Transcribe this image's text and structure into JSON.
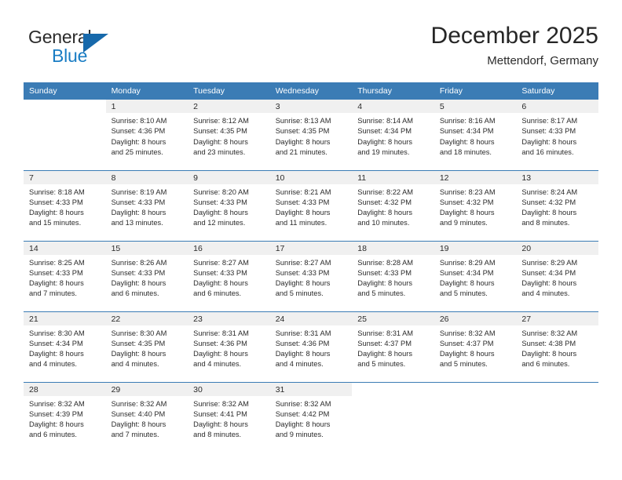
{
  "logo": {
    "word1": "General",
    "word2": "Blue",
    "triangle_color": "#1769ab",
    "blue_text_color": "#1a7dc4"
  },
  "header": {
    "title": "December 2025",
    "subtitle": "Mettendorf, Germany"
  },
  "theme": {
    "header_blue": "#3b7cb5",
    "daynum_band": "#f0f0f0",
    "text": "#2b2b2b"
  },
  "weekdays": [
    "Sunday",
    "Monday",
    "Tuesday",
    "Wednesday",
    "Thursday",
    "Friday",
    "Saturday"
  ],
  "weeks": [
    [
      {
        "day": "",
        "sunrise": "",
        "sunset": "",
        "daylight1": "",
        "daylight2": ""
      },
      {
        "day": "1",
        "sunrise": "Sunrise: 8:10 AM",
        "sunset": "Sunset: 4:36 PM",
        "daylight1": "Daylight: 8 hours",
        "daylight2": "and 25 minutes."
      },
      {
        "day": "2",
        "sunrise": "Sunrise: 8:12 AM",
        "sunset": "Sunset: 4:35 PM",
        "daylight1": "Daylight: 8 hours",
        "daylight2": "and 23 minutes."
      },
      {
        "day": "3",
        "sunrise": "Sunrise: 8:13 AM",
        "sunset": "Sunset: 4:35 PM",
        "daylight1": "Daylight: 8 hours",
        "daylight2": "and 21 minutes."
      },
      {
        "day": "4",
        "sunrise": "Sunrise: 8:14 AM",
        "sunset": "Sunset: 4:34 PM",
        "daylight1": "Daylight: 8 hours",
        "daylight2": "and 19 minutes."
      },
      {
        "day": "5",
        "sunrise": "Sunrise: 8:16 AM",
        "sunset": "Sunset: 4:34 PM",
        "daylight1": "Daylight: 8 hours",
        "daylight2": "and 18 minutes."
      },
      {
        "day": "6",
        "sunrise": "Sunrise: 8:17 AM",
        "sunset": "Sunset: 4:33 PM",
        "daylight1": "Daylight: 8 hours",
        "daylight2": "and 16 minutes."
      }
    ],
    [
      {
        "day": "7",
        "sunrise": "Sunrise: 8:18 AM",
        "sunset": "Sunset: 4:33 PM",
        "daylight1": "Daylight: 8 hours",
        "daylight2": "and 15 minutes."
      },
      {
        "day": "8",
        "sunrise": "Sunrise: 8:19 AM",
        "sunset": "Sunset: 4:33 PM",
        "daylight1": "Daylight: 8 hours",
        "daylight2": "and 13 minutes."
      },
      {
        "day": "9",
        "sunrise": "Sunrise: 8:20 AM",
        "sunset": "Sunset: 4:33 PM",
        "daylight1": "Daylight: 8 hours",
        "daylight2": "and 12 minutes."
      },
      {
        "day": "10",
        "sunrise": "Sunrise: 8:21 AM",
        "sunset": "Sunset: 4:33 PM",
        "daylight1": "Daylight: 8 hours",
        "daylight2": "and 11 minutes."
      },
      {
        "day": "11",
        "sunrise": "Sunrise: 8:22 AM",
        "sunset": "Sunset: 4:32 PM",
        "daylight1": "Daylight: 8 hours",
        "daylight2": "and 10 minutes."
      },
      {
        "day": "12",
        "sunrise": "Sunrise: 8:23 AM",
        "sunset": "Sunset: 4:32 PM",
        "daylight1": "Daylight: 8 hours",
        "daylight2": "and 9 minutes."
      },
      {
        "day": "13",
        "sunrise": "Sunrise: 8:24 AM",
        "sunset": "Sunset: 4:32 PM",
        "daylight1": "Daylight: 8 hours",
        "daylight2": "and 8 minutes."
      }
    ],
    [
      {
        "day": "14",
        "sunrise": "Sunrise: 8:25 AM",
        "sunset": "Sunset: 4:33 PM",
        "daylight1": "Daylight: 8 hours",
        "daylight2": "and 7 minutes."
      },
      {
        "day": "15",
        "sunrise": "Sunrise: 8:26 AM",
        "sunset": "Sunset: 4:33 PM",
        "daylight1": "Daylight: 8 hours",
        "daylight2": "and 6 minutes."
      },
      {
        "day": "16",
        "sunrise": "Sunrise: 8:27 AM",
        "sunset": "Sunset: 4:33 PM",
        "daylight1": "Daylight: 8 hours",
        "daylight2": "and 6 minutes."
      },
      {
        "day": "17",
        "sunrise": "Sunrise: 8:27 AM",
        "sunset": "Sunset: 4:33 PM",
        "daylight1": "Daylight: 8 hours",
        "daylight2": "and 5 minutes."
      },
      {
        "day": "18",
        "sunrise": "Sunrise: 8:28 AM",
        "sunset": "Sunset: 4:33 PM",
        "daylight1": "Daylight: 8 hours",
        "daylight2": "and 5 minutes."
      },
      {
        "day": "19",
        "sunrise": "Sunrise: 8:29 AM",
        "sunset": "Sunset: 4:34 PM",
        "daylight1": "Daylight: 8 hours",
        "daylight2": "and 5 minutes."
      },
      {
        "day": "20",
        "sunrise": "Sunrise: 8:29 AM",
        "sunset": "Sunset: 4:34 PM",
        "daylight1": "Daylight: 8 hours",
        "daylight2": "and 4 minutes."
      }
    ],
    [
      {
        "day": "21",
        "sunrise": "Sunrise: 8:30 AM",
        "sunset": "Sunset: 4:34 PM",
        "daylight1": "Daylight: 8 hours",
        "daylight2": "and 4 minutes."
      },
      {
        "day": "22",
        "sunrise": "Sunrise: 8:30 AM",
        "sunset": "Sunset: 4:35 PM",
        "daylight1": "Daylight: 8 hours",
        "daylight2": "and 4 minutes."
      },
      {
        "day": "23",
        "sunrise": "Sunrise: 8:31 AM",
        "sunset": "Sunset: 4:36 PM",
        "daylight1": "Daylight: 8 hours",
        "daylight2": "and 4 minutes."
      },
      {
        "day": "24",
        "sunrise": "Sunrise: 8:31 AM",
        "sunset": "Sunset: 4:36 PM",
        "daylight1": "Daylight: 8 hours",
        "daylight2": "and 4 minutes."
      },
      {
        "day": "25",
        "sunrise": "Sunrise: 8:31 AM",
        "sunset": "Sunset: 4:37 PM",
        "daylight1": "Daylight: 8 hours",
        "daylight2": "and 5 minutes."
      },
      {
        "day": "26",
        "sunrise": "Sunrise: 8:32 AM",
        "sunset": "Sunset: 4:37 PM",
        "daylight1": "Daylight: 8 hours",
        "daylight2": "and 5 minutes."
      },
      {
        "day": "27",
        "sunrise": "Sunrise: 8:32 AM",
        "sunset": "Sunset: 4:38 PM",
        "daylight1": "Daylight: 8 hours",
        "daylight2": "and 6 minutes."
      }
    ],
    [
      {
        "day": "28",
        "sunrise": "Sunrise: 8:32 AM",
        "sunset": "Sunset: 4:39 PM",
        "daylight1": "Daylight: 8 hours",
        "daylight2": "and 6 minutes."
      },
      {
        "day": "29",
        "sunrise": "Sunrise: 8:32 AM",
        "sunset": "Sunset: 4:40 PM",
        "daylight1": "Daylight: 8 hours",
        "daylight2": "and 7 minutes."
      },
      {
        "day": "30",
        "sunrise": "Sunrise: 8:32 AM",
        "sunset": "Sunset: 4:41 PM",
        "daylight1": "Daylight: 8 hours",
        "daylight2": "and 8 minutes."
      },
      {
        "day": "31",
        "sunrise": "Sunrise: 8:32 AM",
        "sunset": "Sunset: 4:42 PM",
        "daylight1": "Daylight: 8 hours",
        "daylight2": "and 9 minutes."
      },
      {
        "day": "",
        "sunrise": "",
        "sunset": "",
        "daylight1": "",
        "daylight2": ""
      },
      {
        "day": "",
        "sunrise": "",
        "sunset": "",
        "daylight1": "",
        "daylight2": ""
      },
      {
        "day": "",
        "sunrise": "",
        "sunset": "",
        "daylight1": "",
        "daylight2": ""
      }
    ]
  ]
}
